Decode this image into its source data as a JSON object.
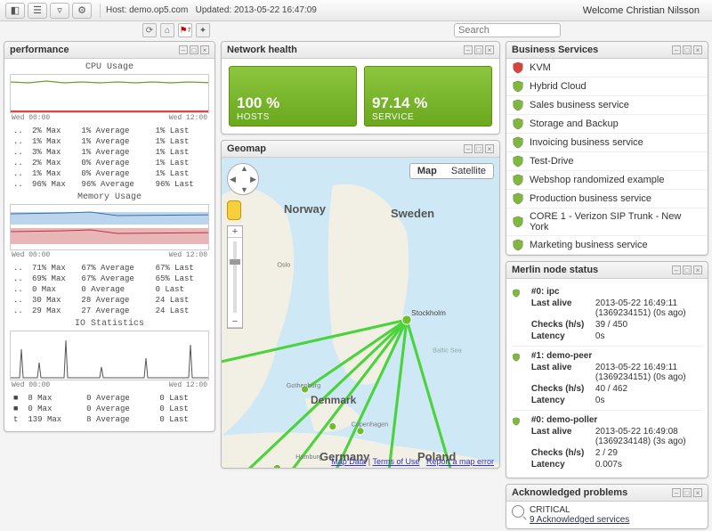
{
  "header": {
    "host_label": "Host:",
    "host": "demo.op5.com",
    "updated_label": "Updated:",
    "updated": "2013-05-22 16:47:09",
    "welcome": "Welcome Christian Nilsson",
    "search_placeholder": "Search",
    "alert_badge": "7"
  },
  "performance": {
    "title": "performance",
    "cpu": {
      "title": "CPU Usage",
      "axis_left": "Wed 00:00",
      "axis_right": "Wed 12:00",
      "rows": [
        {
          "max": "2% Max",
          "avg": "1% Average",
          "last": "1% Last"
        },
        {
          "max": "1% Max",
          "avg": "1% Average",
          "last": "1% Last"
        },
        {
          "max": "3% Max",
          "avg": "1% Average",
          "last": "1% Last"
        },
        {
          "max": "2% Max",
          "avg": "0% Average",
          "last": "1% Last"
        },
        {
          "max": "1% Max",
          "avg": "0% Average",
          "last": "1% Last"
        },
        {
          "max": "96% Max",
          "avg": "96% Average",
          "last": "96% Last"
        }
      ]
    },
    "mem": {
      "title": "Memory Usage",
      "axis_left": "Wed 00:00",
      "axis_right": "Wed 12:00",
      "rows": [
        {
          "max": "71% Max",
          "avg": "67% Average",
          "last": "67% Last"
        },
        {
          "max": "69% Max",
          "avg": "67% Average",
          "last": "65% Last"
        },
        {
          "max": "0 Max",
          "avg": "0 Average",
          "last": "0 Last"
        },
        {
          "max": "30 Max",
          "avg": "28 Average",
          "last": "24 Last"
        },
        {
          "max": "29 Max",
          "avg": "27 Average",
          "last": "24 Last"
        }
      ]
    },
    "io": {
      "title": "IO Statistics",
      "axis_left": "Wed 00:00",
      "axis_right": "Wed 12:00",
      "rows": [
        {
          "max": "8 Max",
          "avg": "0 Average",
          "last": "0 Last"
        },
        {
          "max": "0 Max",
          "avg": "0 Average",
          "last": "0 Last"
        },
        {
          "max": "139 Max",
          "avg": "8 Average",
          "last": "0 Last"
        }
      ]
    }
  },
  "network_health": {
    "title": "Network health",
    "hosts_pct": "100 %",
    "hosts_label": "HOSTS",
    "service_pct": "97.14 %",
    "service_label": "SERVICE"
  },
  "geomap": {
    "title": "Geomap",
    "map_btn": "Map",
    "sat_btn": "Satellite",
    "countries": {
      "norway": "Norway",
      "sweden": "Sweden",
      "denmark": "Denmark",
      "germany": "Germany",
      "poland": "Poland"
    },
    "footer_report": "Report a map error",
    "footer_terms": "Terms of Use",
    "footer_data": "Map Data"
  },
  "business_services": {
    "title": "Business Services",
    "items": [
      {
        "name": "KVM",
        "status": "critical"
      },
      {
        "name": "Hybrid Cloud",
        "status": "ok"
      },
      {
        "name": "Sales business service",
        "status": "ok"
      },
      {
        "name": "Storage and Backup",
        "status": "ok"
      },
      {
        "name": "Invoicing business service",
        "status": "ok"
      },
      {
        "name": "Test-Drive",
        "status": "ok"
      },
      {
        "name": "Webshop randomized example",
        "status": "ok"
      },
      {
        "name": "Production business service",
        "status": "ok"
      },
      {
        "name": "CORE 1 - Verizon SIP Trunk - New York",
        "status": "ok"
      },
      {
        "name": "Marketing business service",
        "status": "ok"
      }
    ]
  },
  "merlin": {
    "title": "Merlin node status",
    "nodes": [
      {
        "id": "#0: ipc",
        "last_alive": "2013-05-22 16:49:11 (1369234151) (0s ago)",
        "checks": "39 / 450",
        "latency": "0s"
      },
      {
        "id": "#1: demo-peer",
        "last_alive": "2013-05-22 16:49:11 (1369234151) (0s ago)",
        "checks": "40 / 462",
        "latency": "0s"
      },
      {
        "id": "#0: demo-poller",
        "last_alive": "2013-05-22 16:49:08 (1369234148) (3s ago)",
        "checks": "2 / 29",
        "latency": "0.007s"
      }
    ],
    "labels": {
      "last_alive": "Last alive",
      "checks": "Checks (h/s)",
      "latency": "Latency"
    }
  },
  "ack": {
    "title": "Acknowledged problems",
    "status": "CRITICAL",
    "line2": "9 Acknowledged services"
  }
}
